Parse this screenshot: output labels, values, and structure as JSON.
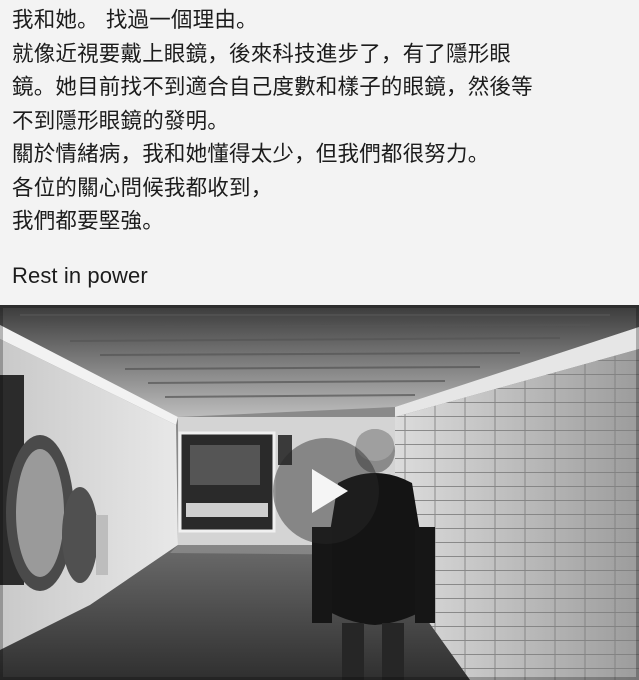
{
  "post": {
    "lines": [
      "我和她。 找過一個理由。",
      "就像近視要戴上眼鏡，後來科技進步了，有了隱形眼",
      "鏡。她目前找不到適合自己度數和樣子的眼鏡，然後等",
      "不到隱形眼鏡的發明。",
      "關於情緒病，我和她懂得太少，但我們都很努力。",
      "各位的關心問候我都收到，",
      "我們都要堅強。"
    ],
    "footer": "Rest in power"
  },
  "media": {
    "type": "video",
    "play_icon": "play-icon",
    "scene": "black-and-white subway tunnel with tiled walls, posters and a person in a hooded jacket and beanie walking away"
  },
  "colors": {
    "background": "#f3f3f3",
    "text": "#1c1c1c",
    "play_overlay": "#282828"
  }
}
